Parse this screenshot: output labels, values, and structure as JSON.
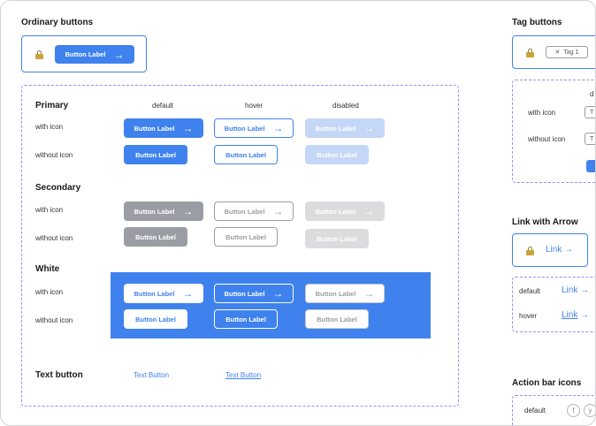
{
  "ordinary": {
    "title": "Ordinary buttons",
    "button_label": "Button Label"
  },
  "columns": {
    "default": "default",
    "hover": "hover",
    "disabled": "disabled"
  },
  "primary": {
    "title": "Primary",
    "row_with_icon": "with icon",
    "row_without_icon": "without icon",
    "label": "Button Label"
  },
  "secondary": {
    "title": "Secondary",
    "row_with_icon": "with icon",
    "row_without_icon": "without icon",
    "label": "Button Label"
  },
  "white": {
    "title": "White",
    "row_with_icon": "with icon",
    "row_without_icon": "without icon",
    "label": "Button Label"
  },
  "text_button": {
    "title": "Text button",
    "default_label": "Text Button",
    "hover_label": "Text Button"
  },
  "tag_buttons": {
    "title": "Tag buttons",
    "tag_label": "Tag 1",
    "col_partial": "d",
    "row_with_icon": "with icon",
    "row_without_icon": "without icon",
    "partial_1": "T",
    "partial_2": "T"
  },
  "link_arrow": {
    "title": "Link with Arrow",
    "link_label": "Link",
    "row_default": "default",
    "row_hover": "hover"
  },
  "action_bar": {
    "title": "Action bar icons",
    "row_default": "default",
    "icon_1": "f",
    "icon_2": "y"
  },
  "colors": {
    "accent": "#3f82ee",
    "dashed": "#9a8ef0",
    "secondary": "#9a9da3"
  },
  "icons": [
    "lock-icon",
    "arrow-right-icon",
    "close-icon",
    "facebook-icon",
    "twitter-icon"
  ]
}
